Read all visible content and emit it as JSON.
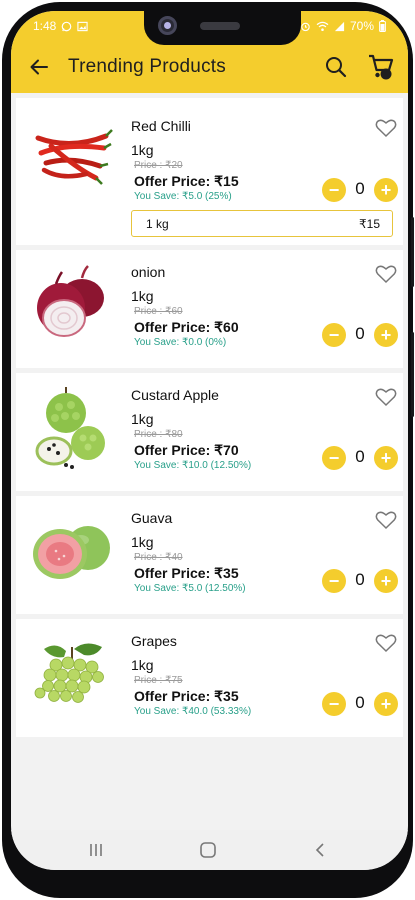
{
  "status": {
    "time": "1:48",
    "battery": "70%"
  },
  "header": {
    "title": "Trending Products",
    "back_icon": "arrow-left-icon",
    "search_icon": "search-icon",
    "cart_icon": "cart-icon"
  },
  "colors": {
    "accent": "#f4cd2d",
    "save_text": "#29a08a"
  },
  "products": [
    {
      "name": "Red Chilli",
      "weight": "1kg",
      "price": "Price : ₹20",
      "offer": "Offer Price: ₹15",
      "save": "You Save: ₹5.0 (25%)",
      "quantity": "0",
      "variant": {
        "label": "1 kg",
        "price": "₹15"
      }
    },
    {
      "name": "onion",
      "weight": "1kg",
      "price": "Price : ₹60",
      "offer": "Offer Price: ₹60",
      "save": "You Save: ₹0.0 (0%)",
      "quantity": "0"
    },
    {
      "name": "Custard Apple",
      "weight": "1kg",
      "price": "Price : ₹80",
      "offer": "Offer Price: ₹70",
      "save": "You Save: ₹10.0 (12.50%)",
      "quantity": "0"
    },
    {
      "name": "Guava",
      "weight": "1kg",
      "price": "Price : ₹40",
      "offer": "Offer Price: ₹35",
      "save": "You Save: ₹5.0 (12.50%)",
      "quantity": "0"
    },
    {
      "name": "Grapes",
      "weight": "1kg",
      "price": "Price : ₹75",
      "offer": "Offer Price: ₹35",
      "save": "You Save: ₹40.0 (53.33%)",
      "quantity": "0"
    }
  ],
  "nav": {
    "recents_icon": "recents-icon",
    "home_icon": "home-icon",
    "back_icon": "back-chevron-icon"
  }
}
